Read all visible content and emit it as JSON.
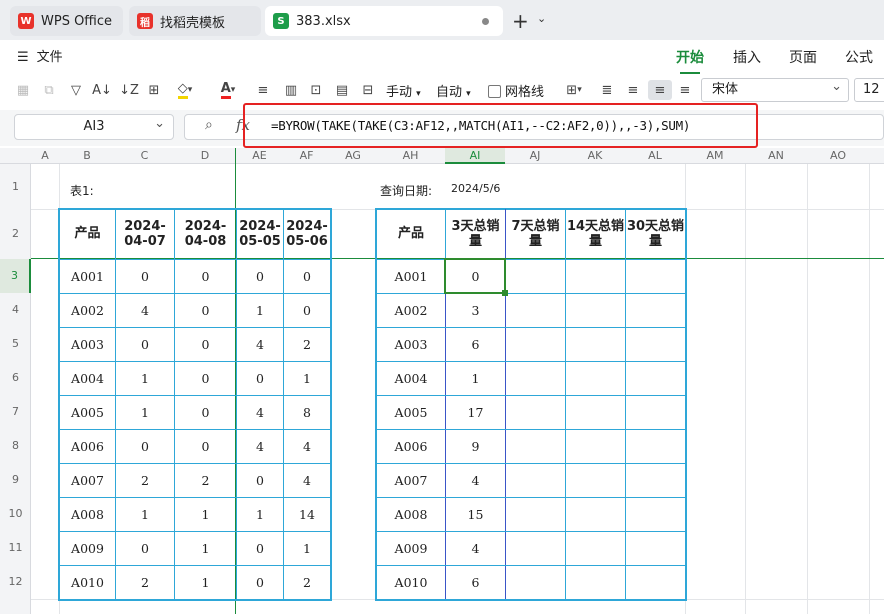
{
  "tabs": {
    "wps": "WPS Office",
    "template": "找稻壳模板",
    "file": "383.xlsx",
    "file_icon": "S"
  },
  "ribbon": {
    "file_menu": "文件",
    "tabs": [
      "开始",
      "插入",
      "页面",
      "公式"
    ]
  },
  "toolbar": {
    "manual": "手动",
    "auto": "自动",
    "gridlines": "网格线",
    "font": "宋体",
    "size": "12"
  },
  "formula_bar": {
    "cell_ref": "AI3",
    "fx": "fx",
    "formula": "=BYROW(TAKE(TAKE(C3:AF12,,MATCH(AI1,--C2:AF2,0)),,-3),SUM)"
  },
  "columns": [
    "A",
    "B",
    "C",
    "D",
    "AE",
    "AF",
    "AG",
    "AH",
    "AI",
    "AJ",
    "AK",
    "AL",
    "AM",
    "AN",
    "AO"
  ],
  "rows": [
    "1",
    "2",
    "3",
    "4",
    "5",
    "6",
    "7",
    "8",
    "9",
    "10",
    "11",
    "12"
  ],
  "sheet": {
    "table1_label": "表1:",
    "query_label": "查询日期:",
    "query_date": "2024/5/6",
    "left_headers": [
      "产品",
      "2024-04-07",
      "2024-04-08",
      "2024-05-05",
      "2024-05-06"
    ],
    "left_rows": [
      [
        "A001",
        "0",
        "0",
        "0",
        "0"
      ],
      [
        "A002",
        "4",
        "0",
        "1",
        "0"
      ],
      [
        "A003",
        "0",
        "0",
        "4",
        "2"
      ],
      [
        "A004",
        "1",
        "0",
        "0",
        "1"
      ],
      [
        "A005",
        "1",
        "0",
        "4",
        "8"
      ],
      [
        "A006",
        "0",
        "0",
        "4",
        "4"
      ],
      [
        "A007",
        "2",
        "2",
        "0",
        "4"
      ],
      [
        "A008",
        "1",
        "1",
        "1",
        "14"
      ],
      [
        "A009",
        "0",
        "1",
        "0",
        "1"
      ],
      [
        "A010",
        "2",
        "1",
        "0",
        "2"
      ]
    ],
    "right_headers": [
      "产品",
      "3天总销量",
      "7天总销量",
      "14天总销量",
      "30天总销量"
    ],
    "right_rows": [
      [
        "A001",
        "0",
        "",
        "",
        ""
      ],
      [
        "A002",
        "3",
        "",
        "",
        ""
      ],
      [
        "A003",
        "6",
        "",
        "",
        ""
      ],
      [
        "A004",
        "1",
        "",
        "",
        ""
      ],
      [
        "A005",
        "17",
        "",
        "",
        ""
      ],
      [
        "A006",
        "9",
        "",
        "",
        ""
      ],
      [
        "A007",
        "4",
        "",
        "",
        ""
      ],
      [
        "A008",
        "15",
        "",
        "",
        ""
      ],
      [
        "A009",
        "4",
        "",
        "",
        ""
      ],
      [
        "A010",
        "6",
        "",
        "",
        ""
      ]
    ]
  },
  "colors": {
    "accent": "#1b8c3c",
    "table_border": "#2ea7d8",
    "highlight_box": "#e52222",
    "selected_cell": "#2e8b2e"
  }
}
